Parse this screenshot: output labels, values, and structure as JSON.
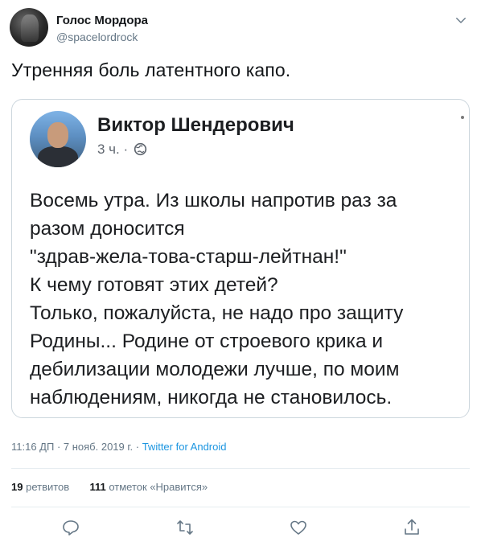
{
  "author": {
    "name": "Голос Мордора",
    "handle": "@spacelordrock"
  },
  "tweet": {
    "text": "Утренняя боль латентного капо."
  },
  "embedded_post": {
    "author": "Виктор Шендерович",
    "time": "3 ч.",
    "separator": "·",
    "lines": [
      "Восемь утра. Из школы напротив раз за",
      "разом доносится",
      "\"здрав-жела-това-старш-лейтнан!\"",
      "К чему готовят этих детей?",
      "Только, пожалуйста, не надо про защиту",
      "Родины... Родине от строевого крика и",
      "дебилизации молодежи лучше, по моим",
      "наблюдениям, никогда не становилось."
    ]
  },
  "meta": {
    "timestamp": "11:16 ДП · 7 нояб. 2019 г. · ",
    "source": "Twitter for Android"
  },
  "stats": {
    "retweets_count": "19",
    "retweets_label": "ретвитов",
    "likes_count": "111",
    "likes_label": "отметок «Нравится»"
  },
  "icons": {
    "reply": "reply-icon",
    "retweet": "retweet-icon",
    "like": "like-icon",
    "share": "share-icon",
    "menu": "chevron-down-icon"
  },
  "colors": {
    "link": "#1b95e0",
    "secondary": "#657786",
    "border": "#ccd6dd"
  }
}
